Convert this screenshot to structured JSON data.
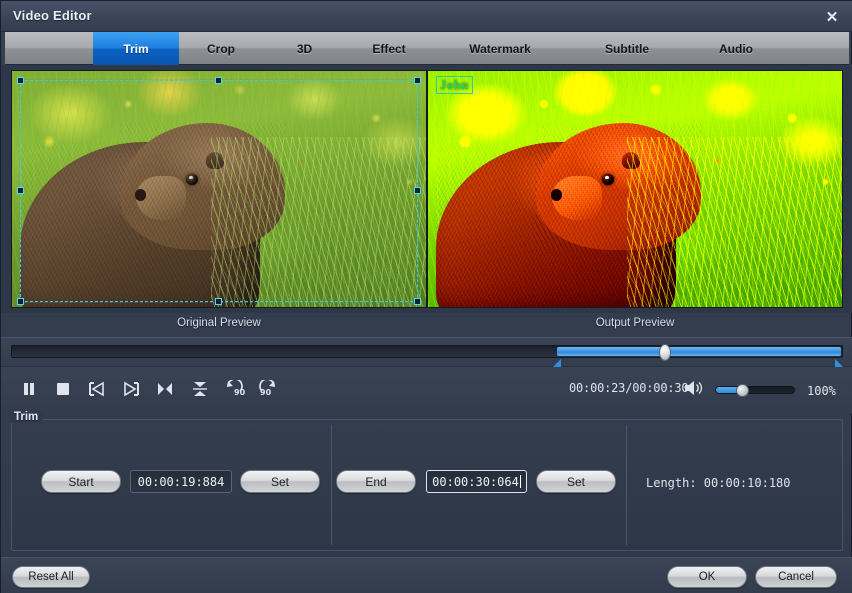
{
  "window": {
    "title": "Video Editor",
    "close_icon": "close-icon",
    "close_glyph": "✕"
  },
  "tabs": [
    {
      "label": "Trim",
      "active": true
    },
    {
      "label": "Crop",
      "active": false
    },
    {
      "label": "3D",
      "active": false
    },
    {
      "label": "Effect",
      "active": false
    },
    {
      "label": "Watermark",
      "active": false
    },
    {
      "label": "Subtitle",
      "active": false
    },
    {
      "label": "Audio",
      "active": false
    }
  ],
  "previews": {
    "original_caption": "Original Preview",
    "output_caption": "Output Preview",
    "watermark_text": "John",
    "watermark_color": "#25d467",
    "crop_selection_color": "#3fc8e8"
  },
  "timeline": {
    "position_percent": 76.5,
    "range_start_percent": 65.5,
    "range_end_percent": 100,
    "accent_color": "#2f8ede"
  },
  "controls": {
    "buttons": [
      {
        "name": "pause-button",
        "icon": "pause-icon",
        "label": "Pause"
      },
      {
        "name": "stop-button",
        "icon": "stop-icon",
        "label": "Stop"
      },
      {
        "name": "previous-frame-button",
        "icon": "previous-frame-icon",
        "label": "Previous Frame"
      },
      {
        "name": "next-frame-button",
        "icon": "next-frame-icon",
        "label": "Next Frame"
      },
      {
        "name": "snapshot-button",
        "icon": "snapshot-icon",
        "label": "Snapshot"
      },
      {
        "name": "flip-vertical-button",
        "icon": "flip-vertical-icon",
        "label": "Flip Vertical"
      },
      {
        "name": "rotate-left-button",
        "icon": "rotate-left-90-icon",
        "label": "Rotate Left 90"
      },
      {
        "name": "rotate-right-button",
        "icon": "rotate-right-90-icon",
        "label": "Rotate Right 90"
      }
    ],
    "time_display": "00:00:23/00:00:30",
    "current_time": "00:00:23",
    "total_time": "00:00:30",
    "volume_icon": "speaker-icon",
    "volume_percent": 30,
    "zoom_label": "100%"
  },
  "trim": {
    "group_label": "Trim",
    "start_button": "Start",
    "start_value": "00:00:19:884",
    "start_set_button": "Set",
    "end_button": "End",
    "end_value": "00:00:30:064",
    "end_set_button": "Set",
    "length_label": "Length:  00:00:10:180"
  },
  "footer": {
    "reset_all": "Reset All",
    "ok": "OK",
    "cancel": "Cancel"
  }
}
